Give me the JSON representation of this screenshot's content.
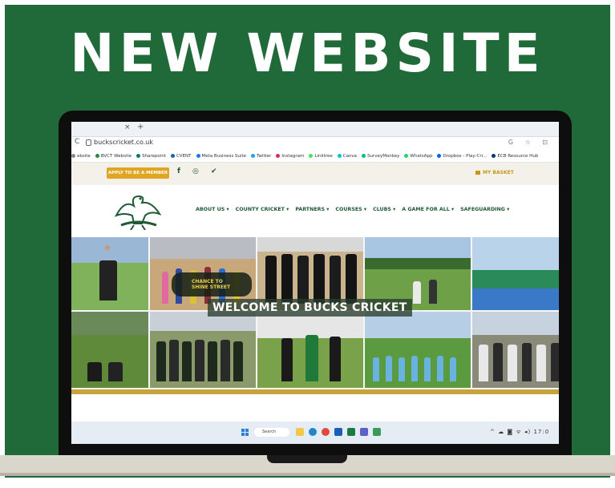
{
  "headline": "NEW WEBSITE",
  "browser": {
    "close_glyph": "×",
    "new_tab_glyph": "+",
    "back_glyph": "C",
    "url": "buckscricket.co.uk",
    "toolbar_glyphs": "G ☆ ⊡",
    "bookmarks": [
      {
        "label": "ebsite",
        "color": "#888888"
      },
      {
        "label": "BVCT Website",
        "color": "#2a8a3a"
      },
      {
        "label": "Sharepoint",
        "color": "#0b7a6e"
      },
      {
        "label": "CVENT",
        "color": "#1d62b0"
      },
      {
        "label": "Meta Business Suite",
        "color": "#1877f2"
      },
      {
        "label": "Twitter",
        "color": "#1da1f2"
      },
      {
        "label": "Instagram",
        "color": "#d62976"
      },
      {
        "label": "Linktree",
        "color": "#43e55e"
      },
      {
        "label": "Canva",
        "color": "#00c4cc"
      },
      {
        "label": "SurveyMonkey",
        "color": "#00bf6f"
      },
      {
        "label": "WhatsApp",
        "color": "#25d366"
      },
      {
        "label": "Dropbox - Play-Cri...",
        "color": "#0061ff"
      },
      {
        "label": "ECB Resource Hub",
        "color": "#003a70"
      }
    ]
  },
  "site": {
    "apply_label": "APPLY TO BE A MEMBER",
    "social_icons": [
      "facebook-icon",
      "instagram-icon",
      "twitter-icon"
    ],
    "social_glyphs": "f ◎ ✔",
    "basket_label": "MY BASKET",
    "nav": [
      "ABOUT US ▾",
      "COUNTY CRICKET ▾",
      "PARTNERS ▾",
      "COURSES ▾",
      "CLUBS ▾",
      "A GAME FOR ALL ▾",
      "SAFEGUARDING ▾"
    ],
    "banner_title": "WELCOME TO BUCKS CRICKET",
    "chance_badge": "CHANCE TO SHINE STREET"
  },
  "taskbar": {
    "search_label": "Search",
    "tray_glyphs": "^ ☁ ◙ ᯤ ◂)",
    "time": "17:0"
  },
  "colors": {
    "brand_green": "#1f6a38",
    "accent_gold": "#e0a522"
  }
}
